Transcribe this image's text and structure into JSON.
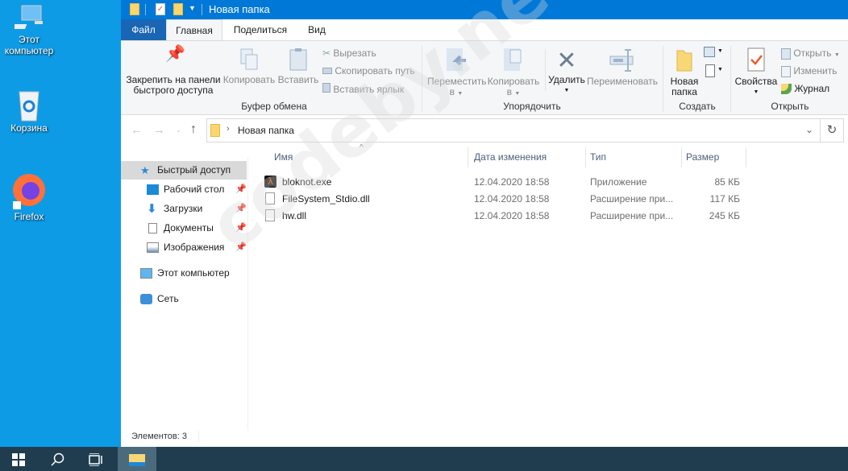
{
  "desktop": {
    "icons": [
      {
        "label": "Этот компьютер",
        "icon": "computer-icon"
      },
      {
        "label": "Корзина",
        "icon": "recycle-bin-icon"
      },
      {
        "label": "Firefox",
        "icon": "firefox-icon"
      }
    ]
  },
  "window": {
    "title": "Новая папка",
    "tabs": [
      {
        "label": "Файл"
      },
      {
        "label": "Главная"
      },
      {
        "label": "Поделиться"
      },
      {
        "label": "Вид"
      }
    ],
    "ribbon": {
      "clipboard": {
        "group": "Буфер обмена",
        "pin1": "Закрепить на панели",
        "pin2": "быстрого доступа",
        "copy": "Копировать",
        "paste": "Вставить",
        "cut": "Вырезать",
        "copy_path": "Скопировать путь",
        "paste_shortcut": "Вставить ярлык"
      },
      "organize": {
        "group": "Упорядочить",
        "move1": "Переместить",
        "move2": "в",
        "copy1": "Копировать",
        "copy2": "в",
        "delete": "Удалить",
        "rename": "Переименовать"
      },
      "create": {
        "group": "Создать",
        "new_folder1": "Новая",
        "new_folder2": "папка"
      },
      "open": {
        "group": "Открыть",
        "properties": "Свойства",
        "open": "Открыть",
        "edit": "Изменить",
        "history": "Журнал"
      }
    },
    "address": {
      "path": "Новая папка"
    },
    "nav": {
      "quick_access": "Быстрый доступ",
      "items": [
        {
          "label": "Рабочий стол"
        },
        {
          "label": "Загрузки"
        },
        {
          "label": "Документы"
        },
        {
          "label": "Изображения"
        }
      ],
      "this_pc": "Этот компьютер",
      "network": "Сеть"
    },
    "columns": {
      "name": "Имя",
      "date": "Дата изменения",
      "type": "Тип",
      "size": "Размер"
    },
    "files": [
      {
        "name": "bloknot.exe",
        "date": "12.04.2020 18:58",
        "type": "Приложение",
        "size": "85 КБ",
        "icon": "exe-icon"
      },
      {
        "name": "FileSystem_Stdio.dll",
        "date": "12.04.2020 18:58",
        "type": "Расширение при...",
        "size": "117 КБ",
        "icon": "dll-icon"
      },
      {
        "name": "hw.dll",
        "date": "12.04.2020 18:58",
        "type": "Расширение при...",
        "size": "245 КБ",
        "icon": "dll-icon"
      }
    ],
    "status": "Элементов: 3"
  },
  "watermark": "codeby.net",
  "colors": {
    "titlebar": "#0078d7",
    "desktop": "#0d9be6",
    "taskbar": "#1f3d4f"
  }
}
